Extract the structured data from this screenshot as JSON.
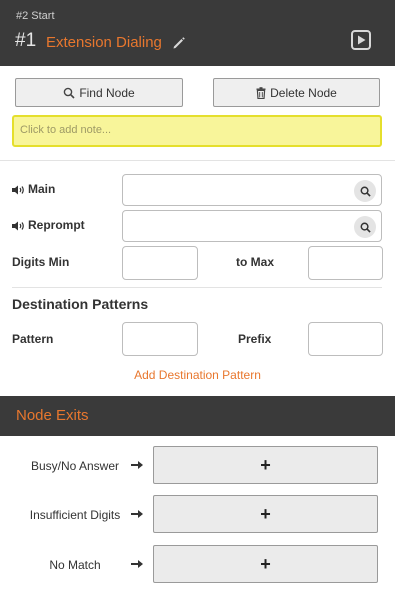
{
  "header": {
    "breadcrumb": "#2 Start",
    "node_number": "#1",
    "node_title": "Extension Dialing"
  },
  "toolbar": {
    "find_label": "Find Node",
    "delete_label": "Delete Node"
  },
  "note": {
    "placeholder": "Click to add note..."
  },
  "prompts": {
    "main_label": "Main",
    "reprompt_label": "Reprompt"
  },
  "digits": {
    "min_label": "Digits Min",
    "max_label": "to Max"
  },
  "destination": {
    "section_title": "Destination Patterns",
    "pattern_label": "Pattern",
    "prefix_label": "Prefix",
    "add_label": "Add Destination Pattern"
  },
  "exits": {
    "title": "Node Exits",
    "items": [
      {
        "label": "Busy/No Answer",
        "button": "+"
      },
      {
        "label": "Insufficient Digits",
        "button": "+"
      },
      {
        "label": "No Match",
        "button": "+"
      }
    ]
  },
  "colors": {
    "accent": "#e8772e",
    "header_bg": "#3a3a3a",
    "note_bg": "#f8f59a"
  }
}
